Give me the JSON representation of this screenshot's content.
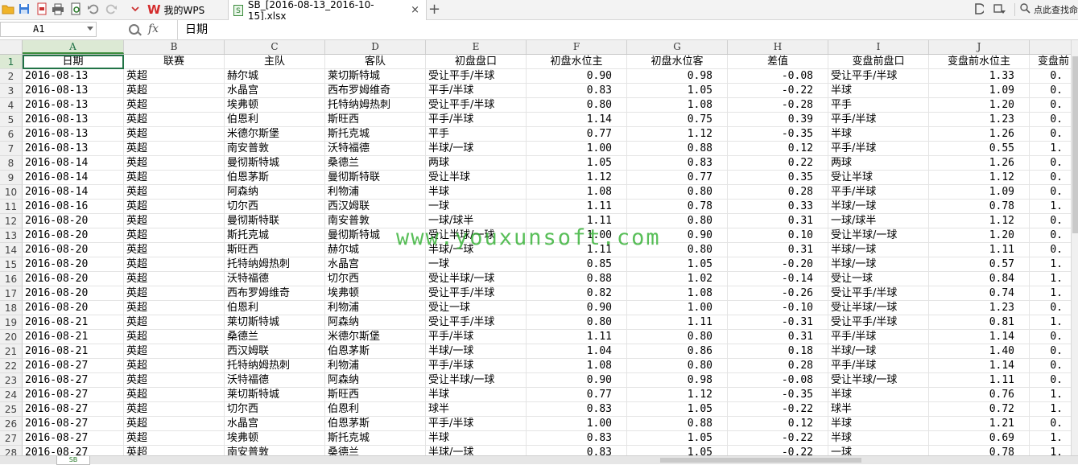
{
  "titlebar": {
    "wps_tab_label": "我的WPS",
    "file_tab_label": "SB_[2016-08-13_2016-10-15].xlsx",
    "add_tab_symbol": "+",
    "close_symbol": "×",
    "search_label": "点此查找命",
    "logo_letter": "W"
  },
  "formula_bar": {
    "name_box": "A1",
    "fx_label": "fx",
    "formula_value": "日期"
  },
  "columns": [
    "A",
    "B",
    "C",
    "D",
    "E",
    "F",
    "G",
    "H",
    "I",
    "J",
    ""
  ],
  "headers": [
    "日期",
    "联赛",
    "主队",
    "客队",
    "初盘盘口",
    "初盘水位主",
    "初盘水位客",
    "差值",
    "变盘前盘口",
    "变盘前水位主",
    "变盘前"
  ],
  "rows": [
    {
      "n": "2",
      "c": [
        "2016-08-13",
        "英超",
        "赫尔城",
        "莱切斯特城",
        "受让平手/半球",
        "0.90",
        "0.98",
        "-0.08",
        "受让平手/半球",
        "1.33",
        "0."
      ]
    },
    {
      "n": "3",
      "c": [
        "2016-08-13",
        "英超",
        "水晶宫",
        "西布罗姆维奇",
        "平手/半球",
        "0.83",
        "1.05",
        "-0.22",
        "半球",
        "1.09",
        "0."
      ]
    },
    {
      "n": "4",
      "c": [
        "2016-08-13",
        "英超",
        "埃弗顿",
        "托特纳姆热刺",
        "受让平手/半球",
        "0.80",
        "1.08",
        "-0.28",
        "平手",
        "1.20",
        "0."
      ]
    },
    {
      "n": "5",
      "c": [
        "2016-08-13",
        "英超",
        "伯恩利",
        "斯旺西",
        "平手/半球",
        "1.14",
        "0.75",
        "0.39",
        "平手/半球",
        "1.23",
        "0."
      ]
    },
    {
      "n": "6",
      "c": [
        "2016-08-13",
        "英超",
        "米德尔斯堡",
        "斯托克城",
        "平手",
        "0.77",
        "1.12",
        "-0.35",
        "半球",
        "1.26",
        "0."
      ]
    },
    {
      "n": "7",
      "c": [
        "2016-08-13",
        "英超",
        "南安普敦",
        "沃特福德",
        "半球/一球",
        "1.00",
        "0.88",
        "0.12",
        "平手/半球",
        "0.55",
        "1."
      ]
    },
    {
      "n": "8",
      "c": [
        "2016-08-14",
        "英超",
        "曼彻斯特城",
        "桑德兰",
        "两球",
        "1.05",
        "0.83",
        "0.22",
        "两球",
        "1.26",
        "0."
      ]
    },
    {
      "n": "9",
      "c": [
        "2016-08-14",
        "英超",
        "伯恩茅斯",
        "曼彻斯特联",
        "受让半球",
        "1.12",
        "0.77",
        "0.35",
        "受让半球",
        "1.12",
        "0."
      ]
    },
    {
      "n": "10",
      "c": [
        "2016-08-14",
        "英超",
        "阿森纳",
        "利物浦",
        "半球",
        "1.08",
        "0.80",
        "0.28",
        "平手/半球",
        "1.09",
        "0."
      ]
    },
    {
      "n": "11",
      "c": [
        "2016-08-16",
        "英超",
        "切尔西",
        "西汉姆联",
        "一球",
        "1.11",
        "0.78",
        "0.33",
        "半球/一球",
        "0.78",
        "1."
      ]
    },
    {
      "n": "12",
      "c": [
        "2016-08-20",
        "英超",
        "曼彻斯特联",
        "南安普敦",
        "一球/球半",
        "1.11",
        "0.80",
        "0.31",
        "一球/球半",
        "1.12",
        "0."
      ]
    },
    {
      "n": "13",
      "c": [
        "2016-08-20",
        "英超",
        "斯托克城",
        "曼彻斯特城",
        "受让半球/一球",
        "1.00",
        "0.90",
        "0.10",
        "受让半球/一球",
        "1.20",
        "0."
      ]
    },
    {
      "n": "14",
      "c": [
        "2016-08-20",
        "英超",
        "斯旺西",
        "赫尔城",
        "半球/一球",
        "1.11",
        "0.80",
        "0.31",
        "半球/一球",
        "1.11",
        "0."
      ]
    },
    {
      "n": "15",
      "c": [
        "2016-08-20",
        "英超",
        "托特纳姆热刺",
        "水晶宫",
        "一球",
        "0.85",
        "1.05",
        "-0.20",
        "半球/一球",
        "0.57",
        "1."
      ]
    },
    {
      "n": "16",
      "c": [
        "2016-08-20",
        "英超",
        "沃特福德",
        "切尔西",
        "受让半球/一球",
        "0.88",
        "1.02",
        "-0.14",
        "受让一球",
        "0.84",
        "1."
      ]
    },
    {
      "n": "17",
      "c": [
        "2016-08-20",
        "英超",
        "西布罗姆维奇",
        "埃弗顿",
        "受让平手/半球",
        "0.82",
        "1.08",
        "-0.26",
        "受让平手/半球",
        "0.74",
        "1."
      ]
    },
    {
      "n": "18",
      "c": [
        "2016-08-20",
        "英超",
        "伯恩利",
        "利物浦",
        "受让一球",
        "0.90",
        "1.00",
        "-0.10",
        "受让半球/一球",
        "1.23",
        "0."
      ]
    },
    {
      "n": "19",
      "c": [
        "2016-08-21",
        "英超",
        "莱切斯特城",
        "阿森纳",
        "受让平手/半球",
        "0.80",
        "1.11",
        "-0.31",
        "受让平手/半球",
        "0.81",
        "1."
      ]
    },
    {
      "n": "20",
      "c": [
        "2016-08-21",
        "英超",
        "桑德兰",
        "米德尔斯堡",
        "平手/半球",
        "1.11",
        "0.80",
        "0.31",
        "平手/半球",
        "1.14",
        "0."
      ]
    },
    {
      "n": "21",
      "c": [
        "2016-08-21",
        "英超",
        "西汉姆联",
        "伯恩茅斯",
        "半球/一球",
        "1.04",
        "0.86",
        "0.18",
        "半球/一球",
        "1.40",
        "0."
      ]
    },
    {
      "n": "22",
      "c": [
        "2016-08-27",
        "英超",
        "托特纳姆热刺",
        "利物浦",
        "平手/半球",
        "1.08",
        "0.80",
        "0.28",
        "平手/半球",
        "1.14",
        "0."
      ]
    },
    {
      "n": "23",
      "c": [
        "2016-08-27",
        "英超",
        "沃特福德",
        "阿森纳",
        "受让半球/一球",
        "0.90",
        "0.98",
        "-0.08",
        "受让半球/一球",
        "1.11",
        "0."
      ]
    },
    {
      "n": "24",
      "c": [
        "2016-08-27",
        "英超",
        "莱切斯特城",
        "斯旺西",
        "半球",
        "0.77",
        "1.12",
        "-0.35",
        "半球",
        "0.76",
        "1."
      ]
    },
    {
      "n": "25",
      "c": [
        "2016-08-27",
        "英超",
        "切尔西",
        "伯恩利",
        "球半",
        "0.83",
        "1.05",
        "-0.22",
        "球半",
        "0.72",
        "1."
      ]
    },
    {
      "n": "26",
      "c": [
        "2016-08-27",
        "英超",
        "水晶宫",
        "伯恩茅斯",
        "平手/半球",
        "1.00",
        "0.88",
        "0.12",
        "半球",
        "1.21",
        "0."
      ]
    },
    {
      "n": "27",
      "c": [
        "2016-08-27",
        "英超",
        "埃弗顿",
        "斯托克城",
        "半球",
        "0.83",
        "1.05",
        "-0.22",
        "半球",
        "0.69",
        "1."
      ]
    },
    {
      "n": "28",
      "c": [
        "2016-08-27",
        "英超",
        "南安普敦",
        "桑德兰",
        "半球/一球",
        "0.83",
        "1.05",
        "-0.22",
        "一球",
        "0.78",
        "1."
      ]
    }
  ],
  "watermark": "www.youxunsoft.com",
  "sheet_tab": "SB",
  "accent_color": "#217346"
}
